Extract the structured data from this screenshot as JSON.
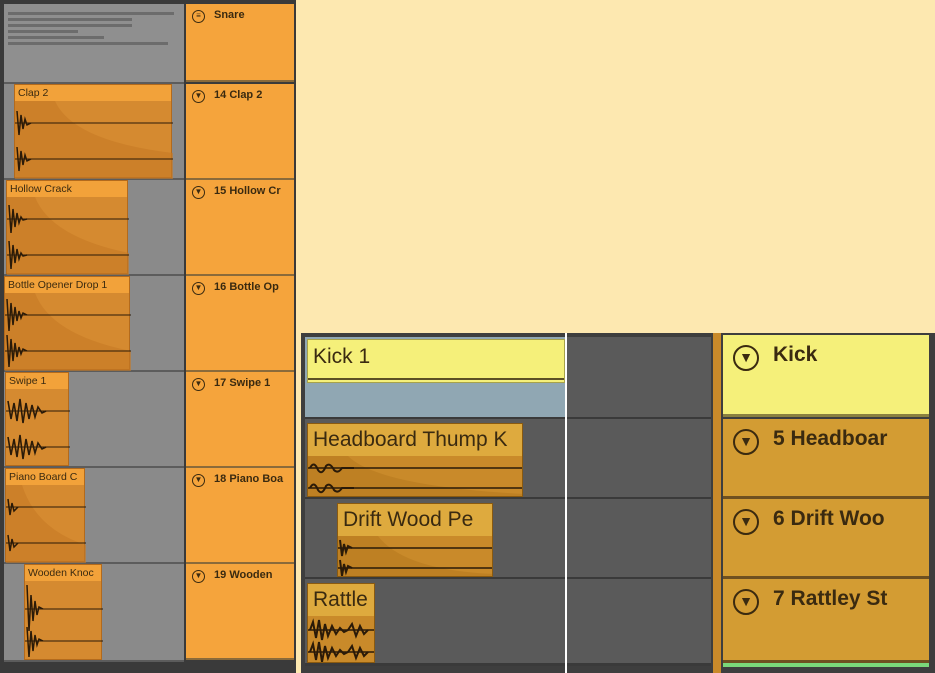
{
  "colors": {
    "background": "#fde8b0",
    "clip_orange": "#f2a23a",
    "clip_orange_dark": "#d58a30",
    "track_yellow": "#f5f07a",
    "track_gold": "#d39c33",
    "selection_blue": "#90a7b3"
  },
  "left": {
    "top_track": {
      "name": "Snare",
      "icon": "group-fold-icon"
    },
    "tracks": [
      {
        "clip": "Clap 2",
        "number": "14",
        "name": "Clap 2"
      },
      {
        "clip": "Hollow Crack",
        "number": "15",
        "name": "Hollow Cr"
      },
      {
        "clip": "Bottle Opener Drop 1",
        "number": "16",
        "name": "Bottle Op"
      },
      {
        "clip": "Swipe 1",
        "number": "17",
        "name": "Swipe 1"
      },
      {
        "clip": "Piano Board C",
        "number": "18",
        "name": "Piano Boa"
      },
      {
        "clip": "Wooden Knoc",
        "number": "19",
        "name": "Wooden"
      }
    ]
  },
  "right": {
    "tracks": [
      {
        "clip": "Kick 1",
        "number": "",
        "name": "Kick"
      },
      {
        "clip": "Headboard Thump K",
        "number": "5",
        "name": "Headboar"
      },
      {
        "clip": "Drift Wood Pe",
        "number": "6",
        "name": "Drift Woo"
      },
      {
        "clip": "Rattle",
        "number": "7",
        "name": "Rattley St"
      }
    ]
  }
}
